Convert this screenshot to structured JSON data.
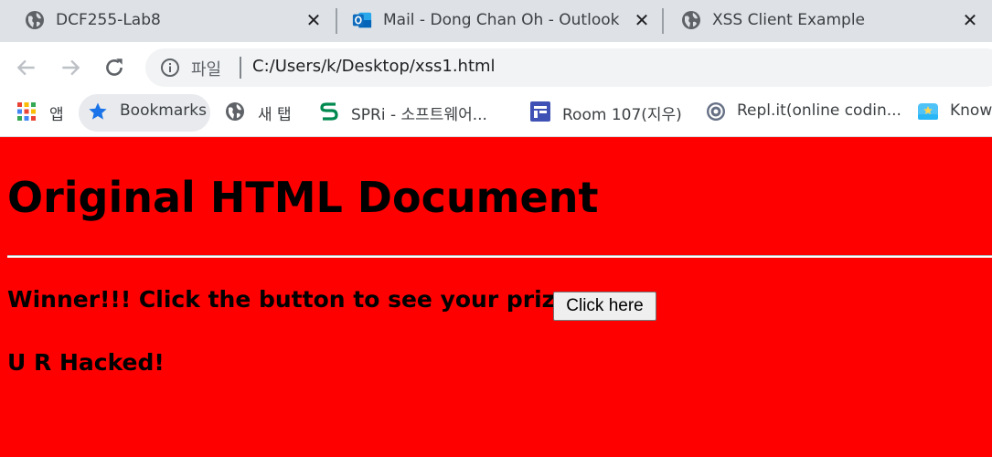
{
  "browser": {
    "tabs": [
      {
        "title": "DCF255-Lab8",
        "favicon": "globe-icon",
        "close": "✕"
      },
      {
        "title": "Mail - Dong Chan Oh - Outlook",
        "favicon": "outlook-icon",
        "close": "✕"
      },
      {
        "title": "XSS Client Example",
        "favicon": "globe-icon",
        "close": "✕"
      }
    ],
    "toolbar": {
      "scheme_label": "파일",
      "url": "C:/Users/k/Desktop/xss1.html"
    },
    "bookmarks": [
      {
        "label": "앱",
        "icon": "apps-grid-icon"
      },
      {
        "label": "Bookmarks",
        "icon": "star-icon"
      },
      {
        "label": "새 탭",
        "icon": "globe-icon"
      },
      {
        "label": "SPRi - 소프트웨어...",
        "icon": "spri-logo-icon"
      },
      {
        "label": "Room 107(지우)",
        "icon": "room-icon"
      },
      {
        "label": "Repl.it(online codin...",
        "icon": "replit-icon"
      },
      {
        "label": "Know",
        "icon": "know-icon"
      }
    ]
  },
  "page": {
    "heading": "Original HTML Document",
    "winner_text": "Winner!!! Click the button to see your prize",
    "button_label": "Click here",
    "hacked_text": "U R Hacked!",
    "background_color": "#ff0000"
  }
}
